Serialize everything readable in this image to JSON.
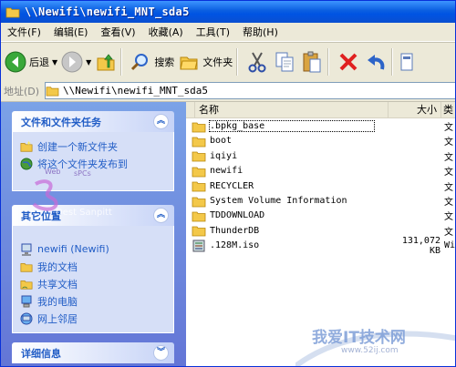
{
  "window": {
    "title": "\\\\Newifi\\newifi_MNT_sda5"
  },
  "menu": [
    "文件(F)",
    "编辑(E)",
    "查看(V)",
    "收藏(A)",
    "工具(T)",
    "帮助(H)"
  ],
  "toolbar": {
    "back": "后退",
    "search": "搜索",
    "folders": "文件夹"
  },
  "address": {
    "label": "地址(D)",
    "value": "\\\\Newifi\\newifi_MNT_sda5"
  },
  "tasks": {
    "title": "文件和文件夹任务",
    "items": [
      "创建一个新文件夹",
      "将这个文件夹发布到"
    ]
  },
  "other": {
    "title": "其它位置",
    "items": [
      "newifi (Newifi)",
      "我的文档",
      "共享文档",
      "我的电脑",
      "网上邻居"
    ]
  },
  "details": {
    "title": "详细信息"
  },
  "columns": {
    "name": "名称",
    "size": "大小",
    "type": "类"
  },
  "files": [
    {
      "name": ".bpkg_base",
      "size": "",
      "type": "文",
      "icon": "folder-icon"
    },
    {
      "name": "boot",
      "size": "",
      "type": "文",
      "icon": "folder-icon"
    },
    {
      "name": "iqiyi",
      "size": "",
      "type": "文",
      "icon": "folder-icon"
    },
    {
      "name": "newifi",
      "size": "",
      "type": "文",
      "icon": "folder-icon"
    },
    {
      "name": "RECYCLER",
      "size": "",
      "type": "文",
      "icon": "folder-icon"
    },
    {
      "name": "System Volume Information",
      "size": "",
      "type": "文",
      "icon": "folder-icon"
    },
    {
      "name": "TDDOWNLOAD",
      "size": "",
      "type": "文",
      "icon": "folder-icon"
    },
    {
      "name": "ThunderDB",
      "size": "",
      "type": "文",
      "icon": "folder-icon"
    },
    {
      "name": ".128M.iso",
      "size": "131,072 KB",
      "type": "Wi",
      "icon": "iso-file-icon"
    }
  ],
  "watermarks": {
    "logo_top": "Web",
    "logo_mid": "sPCs",
    "logo_text": "Dest Sanpitt",
    "site_cn": "我爱IT技术网",
    "site_url": "www.52ij.com"
  }
}
